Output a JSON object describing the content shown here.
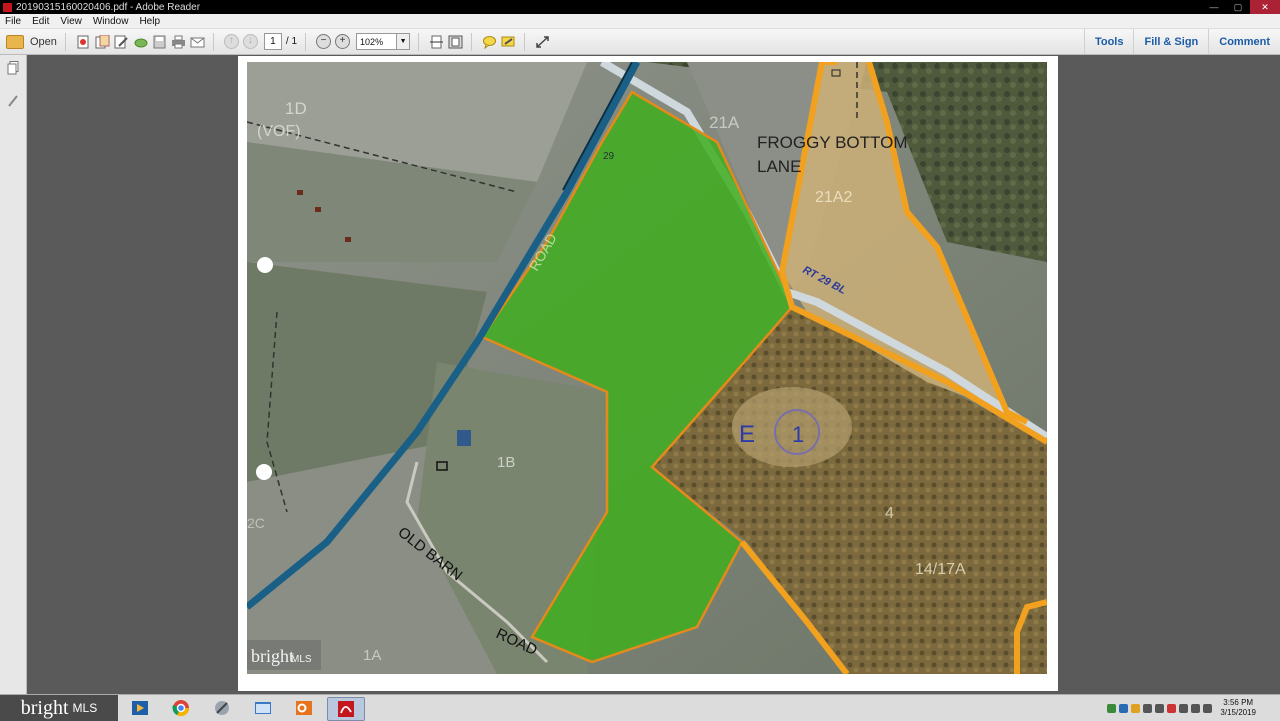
{
  "window": {
    "title": "20190315160020406.pdf - Adobe Reader",
    "minimize": "—",
    "maximize": "▢",
    "close": "✕"
  },
  "menu": {
    "items": [
      "File",
      "Edit",
      "View",
      "Window",
      "Help"
    ]
  },
  "toolbar": {
    "open_label": "Open",
    "page_current": "1",
    "page_total": "/ 1",
    "zoom_value": "102%",
    "tools_label": "Tools",
    "fill_sign_label": "Fill & Sign",
    "comment_label": "Comment"
  },
  "map": {
    "labels": {
      "parcel_1d": "1D",
      "vof": "(VOF)",
      "parcel_21a": "21A",
      "froggy_line1": "FROGGY BOTTOM",
      "froggy_line2": "LANE",
      "parcel_21a2": "21A2",
      "route_29": "29",
      "road_label": "ROAD",
      "rt_label": "RT 29 BL",
      "parcel_1b": "1B",
      "zone_e": "E",
      "zone_1": "1",
      "parcel_4": "4",
      "parcel_14_17a": "14/17A",
      "old_barn": "OLD BARN",
      "road_bottom": "ROAD",
      "parcel_1a": "1A",
      "parcel_2c": "2C"
    },
    "watermark_small": "bright",
    "watermark_small_mls": "MLS",
    "colors": {
      "highlight": "#3fae1f",
      "boundary": "#f2a11e",
      "road": "#1a5f86"
    }
  },
  "watermark": {
    "brand": "bright",
    "suffix": "MLS"
  },
  "taskbar": {
    "time": "3:56 PM",
    "date": "3/15/2019"
  }
}
